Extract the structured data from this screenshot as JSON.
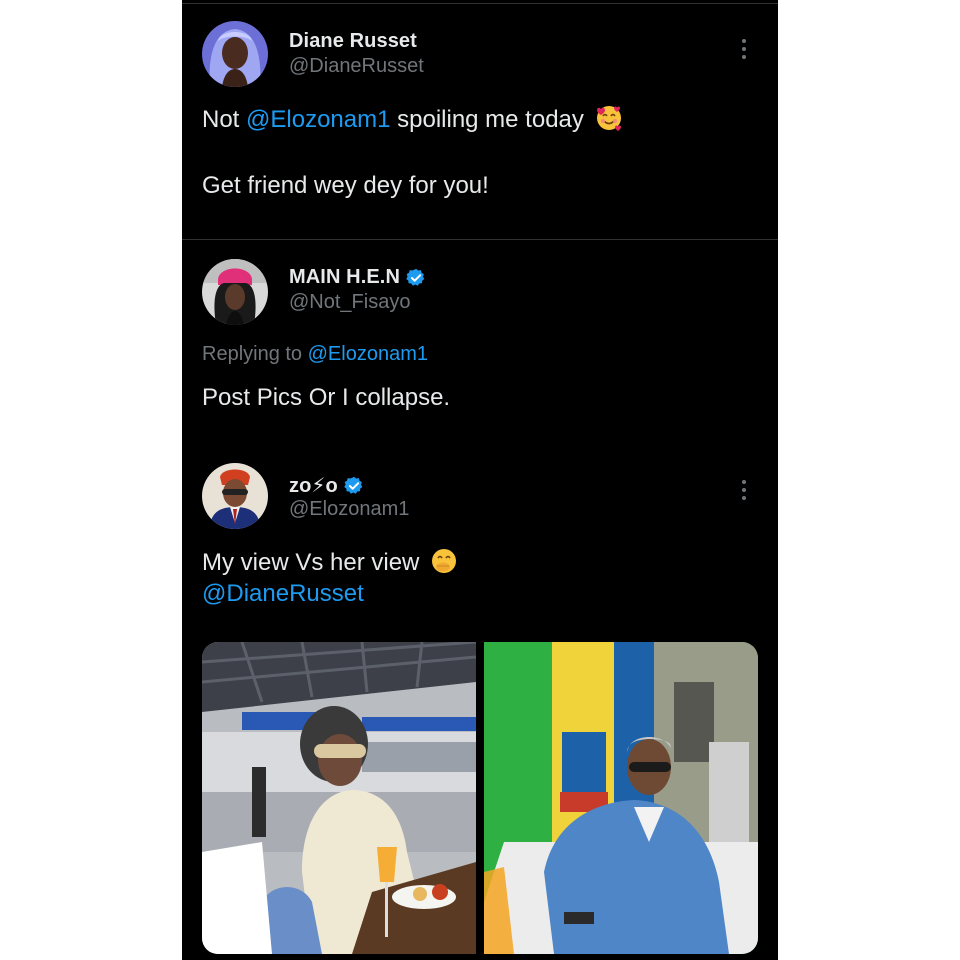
{
  "tweet1": {
    "display_name": "Diane Russet",
    "handle": "@DianeRusset",
    "text_prefix": "Not ",
    "mention": "@Elozonam1",
    "text_suffix": " spoiling me today",
    "emoji": "smiling-face-with-hearts",
    "line2": "Get friend wey dey for you!"
  },
  "reply": {
    "display_name": "MAIN H.E.N",
    "handle": "@Not_Fisayo",
    "verified": true,
    "replying_to_label": "Replying to ",
    "replying_to_handle": "@Elozonam1",
    "text": "Post Pics Or I collapse."
  },
  "tweet3": {
    "display_name": "ᴢᴏ⚡ᴏ",
    "handle": "@Elozonam1",
    "verified": true,
    "text": "My view Vs her view",
    "emoji": "face-with-hand-over-mouth",
    "mention": "@DianeRusset",
    "media": [
      {
        "name": "woman-seated-at-expo-photo"
      },
      {
        "name": "man-seated-at-expo-photo"
      }
    ]
  },
  "colors": {
    "background": "#000000",
    "text": "#e7e9ea",
    "secondary": "#71767b",
    "link": "#1d9bf0",
    "divider": "#2f3336"
  }
}
